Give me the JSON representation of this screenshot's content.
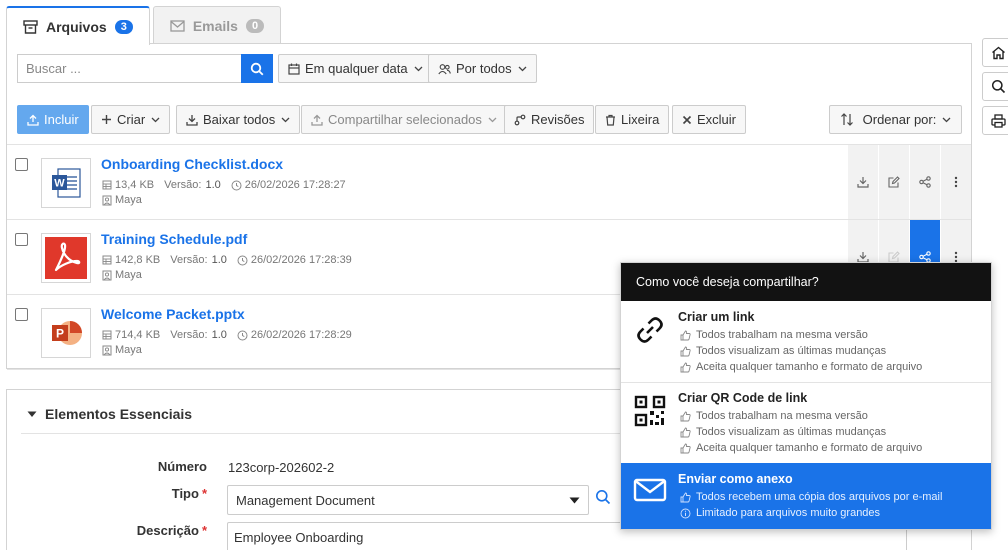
{
  "tabs": [
    {
      "label": "Arquivos",
      "count": "3",
      "icon": "archive-icon"
    },
    {
      "label": "Emails",
      "count": "0",
      "icon": "envelope-icon"
    }
  ],
  "toolbar": {
    "search_placeholder": "Buscar ...",
    "date_filter": "Em qualquer data",
    "user_filter": "Por todos",
    "include": "Incluir",
    "create": "Criar",
    "download_all": "Baixar todos",
    "share_selected": "Compartilhar selecionados",
    "revisions": "Revisões",
    "trash": "Lixeira",
    "delete": "Excluir",
    "sort": "Ordenar por:"
  },
  "files": [
    {
      "name": "Onboarding Checklist.docx",
      "size": "13,4 KB",
      "version_label": "Versão:",
      "version": "1.0",
      "date": "26/02/2026 17:28:27",
      "owner": "Maya",
      "type": "word"
    },
    {
      "name": "Training Schedule.pdf",
      "size": "142,8 KB",
      "version_label": "Versão:",
      "version": "1.0",
      "date": "26/02/2026 17:28:39",
      "owner": "Maya",
      "type": "pdf"
    },
    {
      "name": "Welcome Packet.pptx",
      "size": "714,4 KB",
      "version_label": "Versão:",
      "version": "1.0",
      "date": "26/02/2026 17:28:29",
      "owner": "Maya",
      "type": "powerpoint"
    }
  ],
  "essentials": {
    "title": "Elementos Essenciais",
    "number_label": "Número",
    "number_value": "123corp-202602-2",
    "type_label": "Tipo",
    "type_value": "Management Document",
    "description_label": "Descrição",
    "description_value": "Employee Onboarding",
    "required_mark": "*"
  },
  "share_popup": {
    "title": "Como você deseja compartilhar?",
    "options": [
      {
        "title": "Criar um link",
        "features": [
          "Todos trabalham na mesma versão",
          "Todos visualizam as últimas mudanças",
          "Aceita qualquer tamanho e formato de arquivo"
        ]
      },
      {
        "title": "Criar QR Code de link",
        "features": [
          "Todos trabalham na mesma versão",
          "Todos visualizam as últimas mudanças",
          "Aceita qualquer tamanho e formato de arquivo"
        ]
      },
      {
        "title": "Enviar como anexo",
        "features": [
          "Todos recebem uma cópia dos arquivos por e-mail",
          "Limitado para arquivos muito grandes"
        ]
      }
    ]
  },
  "colors": {
    "accent": "#1a73e8",
    "popup_header": "#121212"
  }
}
